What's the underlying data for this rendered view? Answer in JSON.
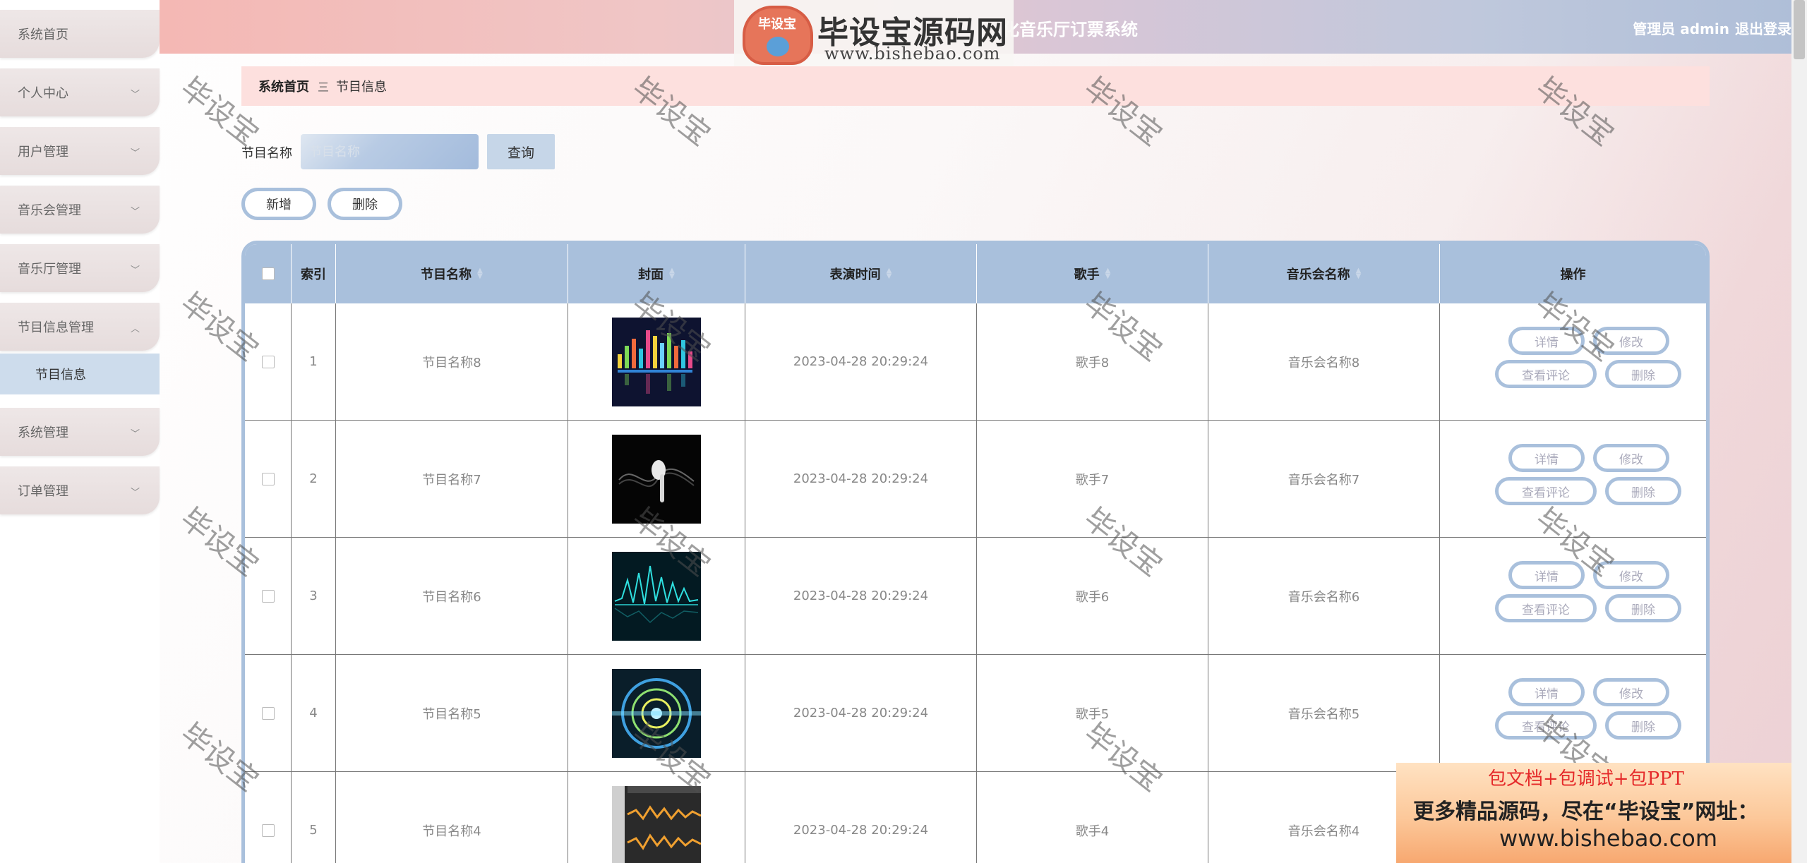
{
  "sidebar": {
    "items": [
      {
        "label": "系统首页"
      },
      {
        "label": "个人中心"
      },
      {
        "label": "用户管理"
      },
      {
        "label": "音乐会管理"
      },
      {
        "label": "音乐厅管理"
      },
      {
        "label": "节目信息管理"
      },
      {
        "label": "系统管理"
      },
      {
        "label": "订单管理"
      }
    ],
    "submenu_label": "节目信息"
  },
  "header": {
    "title": "…化音乐厅订票系统",
    "admin": "管理员 admin",
    "logout": "退出登录",
    "logo_badge": "毕设宝",
    "logo_name": "毕设宝源码网",
    "logo_url": "www.bishebao.com"
  },
  "breadcrumb": {
    "home": "系统首页",
    "sep": "三",
    "current": "节目信息"
  },
  "search": {
    "label": "节目名称",
    "placeholder": "节目名称",
    "button": "查询"
  },
  "toolbar": {
    "add": "新增",
    "delete": "删除"
  },
  "table": {
    "headers": {
      "index": "索引",
      "name": "节目名称",
      "cover": "封面",
      "time": "表演时间",
      "singer": "歌手",
      "concert": "音乐会名称",
      "ops": "操作"
    },
    "actions": {
      "detail": "详情",
      "edit": "修改",
      "comments": "查看评论",
      "delete": "删除"
    },
    "rows": [
      {
        "index": "1",
        "name": "节目名称8",
        "time": "2023-04-28 20:29:24",
        "singer": "歌手8",
        "concert": "音乐会名称8"
      },
      {
        "index": "2",
        "name": "节目名称7",
        "time": "2023-04-28 20:29:24",
        "singer": "歌手7",
        "concert": "音乐会名称7"
      },
      {
        "index": "3",
        "name": "节目名称6",
        "time": "2023-04-28 20:29:24",
        "singer": "歌手6",
        "concert": "音乐会名称6"
      },
      {
        "index": "4",
        "name": "节目名称5",
        "time": "2023-04-28 20:29:24",
        "singer": "歌手5",
        "concert": "音乐会名称5"
      },
      {
        "index": "5",
        "name": "节目名称4",
        "time": "2023-04-28 20:29:24",
        "singer": "歌手4",
        "concert": "音乐会名称4"
      }
    ]
  },
  "watermark": "毕设宝",
  "ad": {
    "line1": "包文档+包调试+包PPT",
    "line2": "更多精品源码，尽在“毕设宝”网址：",
    "line3": "www.bishebao.com"
  },
  "colors": {
    "accent": "#a9c0dc",
    "breadcrumb_bg": "#fde0de",
    "sidebar_active": "#cddcec"
  }
}
